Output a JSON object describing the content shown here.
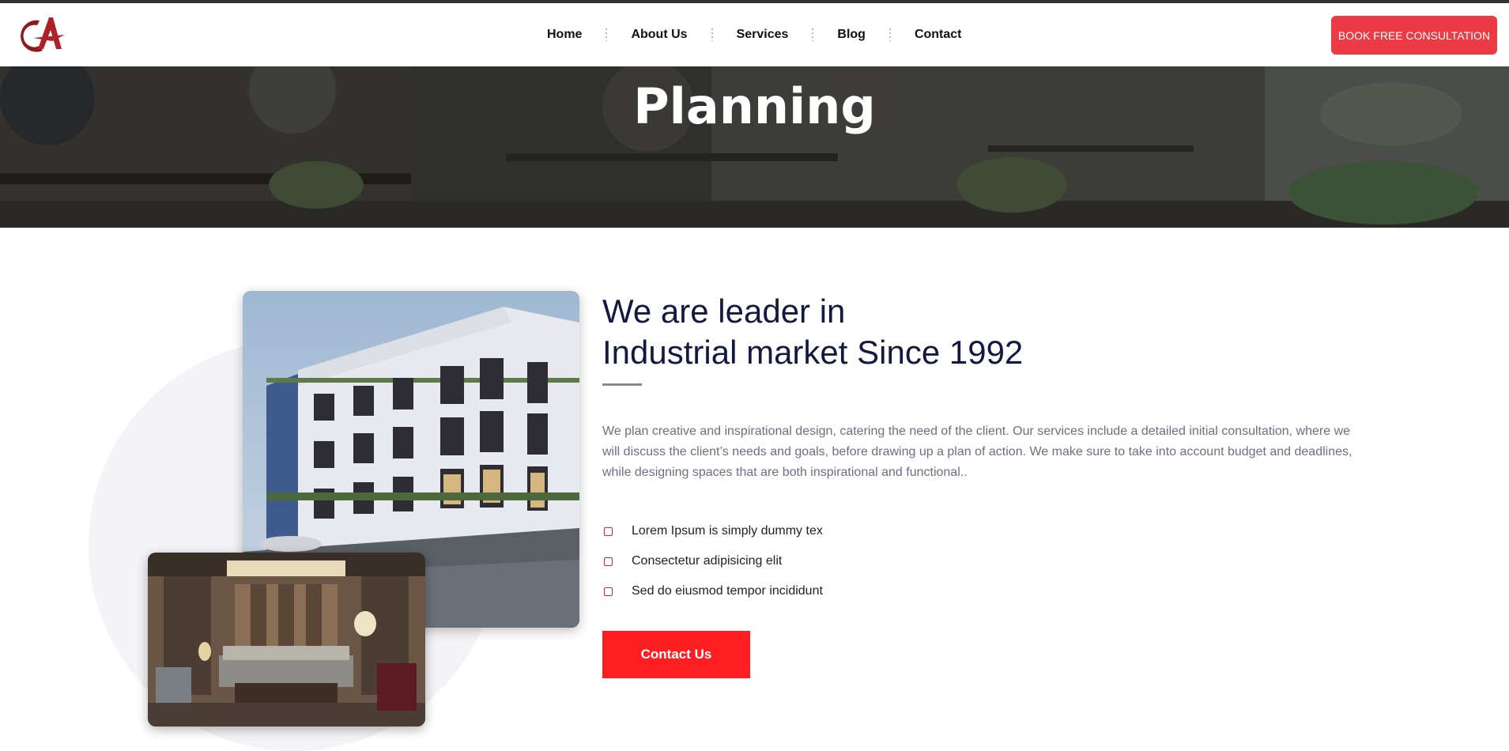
{
  "header": {
    "logo_alt": "CA logo",
    "nav": [
      {
        "label": "Home"
      },
      {
        "label": "About Us"
      },
      {
        "label": "Services"
      },
      {
        "label": "Blog"
      },
      {
        "label": "Contact"
      }
    ],
    "cta_label": "BOOK FREE CONSULTATION"
  },
  "hero": {
    "title": "Planning"
  },
  "about": {
    "heading_line1": "We are leader in",
    "heading_line2": "Industrial market Since 1992",
    "paragraph": "We plan creative and inspirational design, catering the need of the client. Our services include a detailed initial consultation, where we will discuss the client’s needs and goals, before drawing up a plan of action. We make sure to take into account budget and deadlines, while designing spaces that are both inspirational and functional..",
    "list": [
      {
        "text": "Lorem Ipsum is simply dummy tex"
      },
      {
        "text": "Consectetur adipisicing elit"
      },
      {
        "text": "Sed do eiusmod tempor incididunt"
      }
    ],
    "button_label": "Contact Us"
  },
  "colors": {
    "accent": "#ec3b45",
    "button_red": "#ff1f23",
    "heading_navy": "#14193f",
    "paragraph_gray": "#6b6f85"
  },
  "icons": {
    "list_marker": "checkbox-icon"
  }
}
